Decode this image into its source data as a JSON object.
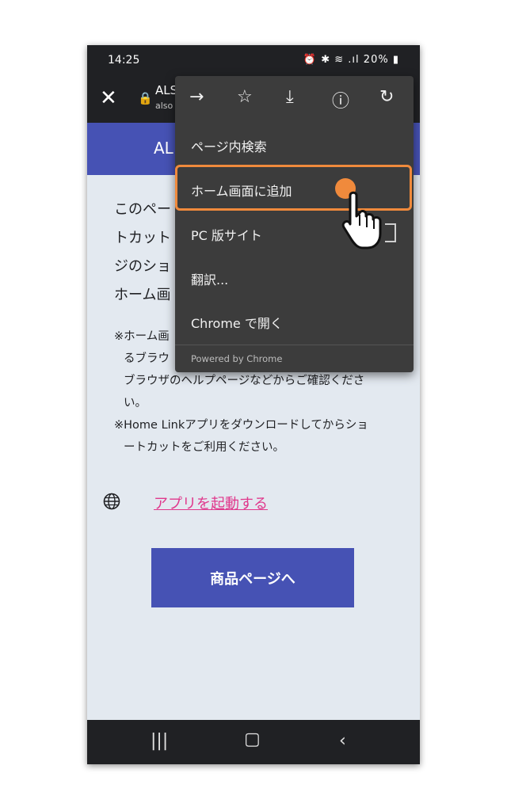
{
  "status_bar": {
    "time": "14:25",
    "icons_text": "⏰ ✱ ≋ .ıl",
    "battery": "20%"
  },
  "browser_bar": {
    "close_icon": "close-icon",
    "title": "ALS",
    "url": "also"
  },
  "page": {
    "header_title": "AL",
    "body_lines": [
      "このペー",
      "トカット",
      "ジのショ",
      "ホーム画"
    ],
    "note_lines": [
      "※ホーム画",
      "るブラウ",
      "ブラウザのヘルプページなどからご確認くださ",
      "い。",
      "※Home Linkアプリをダウンロードしてからショ",
      "ートカットをご利用ください。"
    ],
    "app_link": "アプリを起動する",
    "cta_button": "商品ページへ"
  },
  "menu": {
    "tools": [
      "forward-icon",
      "star-icon",
      "download-icon",
      "info-icon",
      "refresh-icon"
    ],
    "items": [
      {
        "label": "ページ内検索"
      },
      {
        "label": "ホーム画面に追加"
      },
      {
        "label": "PC 版サイト"
      },
      {
        "label": "翻訳..."
      },
      {
        "label": "Chrome で開く"
      }
    ],
    "footer": "Powered by Chrome"
  },
  "colors": {
    "brand_blue": "#4652b4",
    "highlight_orange": "#f08a3c",
    "link_pink": "#e0388c",
    "menu_bg": "#3c3c3c"
  }
}
